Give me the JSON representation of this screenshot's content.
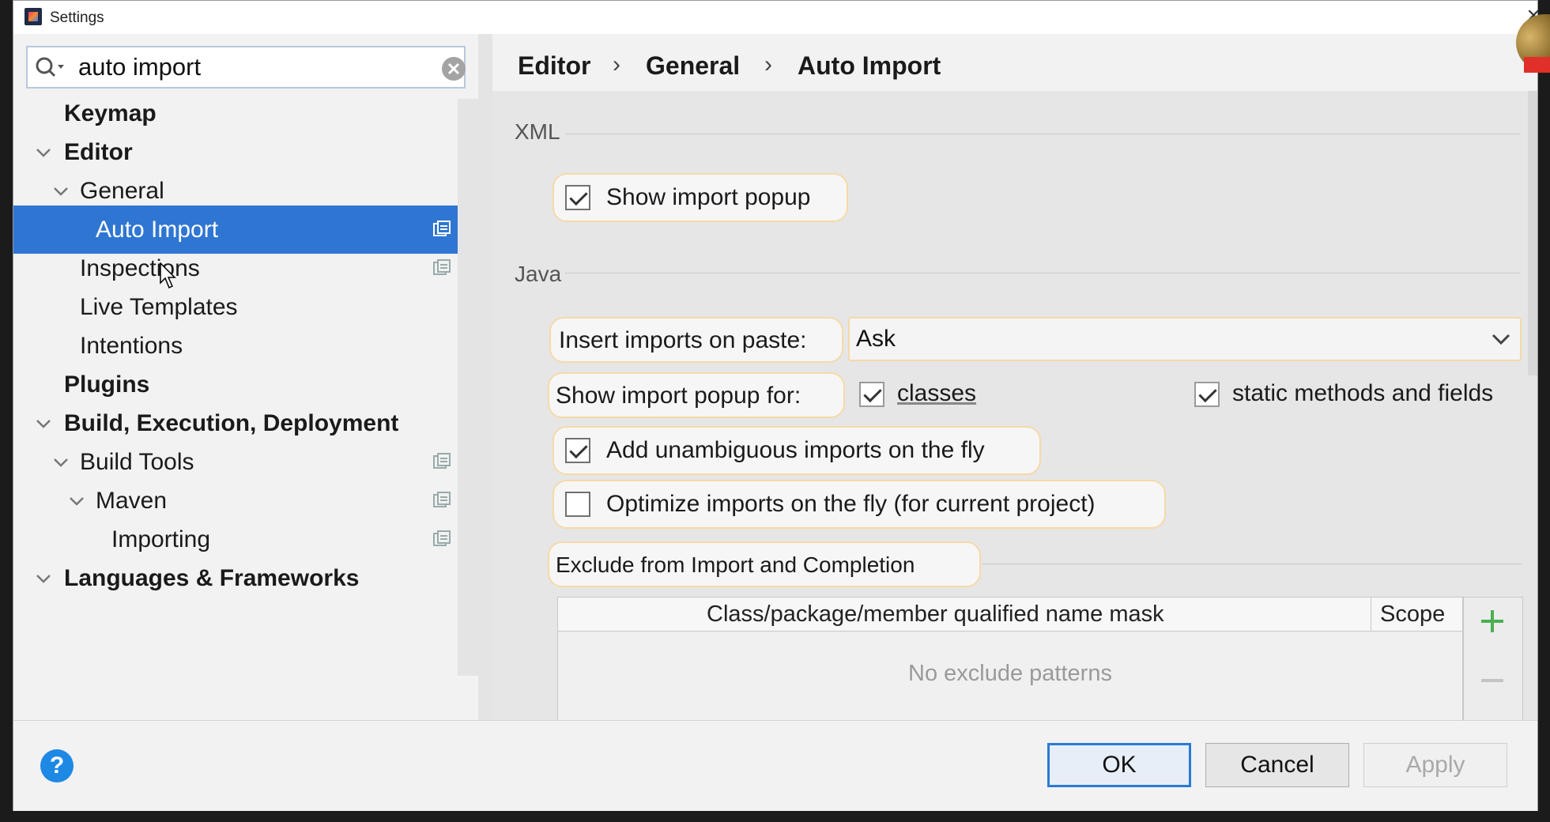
{
  "window": {
    "title": "Settings"
  },
  "search": {
    "value": "auto import"
  },
  "tree": [
    {
      "label": "Keymap",
      "bold": true,
      "expand": "none"
    },
    {
      "label": "Editor",
      "bold": true,
      "expand": "down"
    },
    {
      "label": "General",
      "bold": false,
      "expand": "down"
    },
    {
      "label": "Auto Import",
      "bold": false,
      "expand": "none",
      "selected": true
    },
    {
      "label": "Inspections",
      "bold": false,
      "expand": "none"
    },
    {
      "label": "Live Templates",
      "bold": false,
      "expand": "none"
    },
    {
      "label": "Intentions",
      "bold": false,
      "expand": "none"
    },
    {
      "label": "Plugins",
      "bold": true,
      "expand": "none"
    },
    {
      "label": "Build, Execution, Deployment",
      "bold": true,
      "expand": "down"
    },
    {
      "label": "Build Tools",
      "bold": false,
      "expand": "down"
    },
    {
      "label": "Maven",
      "bold": false,
      "expand": "down"
    },
    {
      "label": "Importing",
      "bold": false,
      "expand": "none"
    },
    {
      "label": "Languages & Frameworks",
      "bold": true,
      "expand": "down"
    }
  ],
  "breadcrumb": [
    "Editor",
    "General",
    "Auto Import"
  ],
  "xml": {
    "section": "XML",
    "show_import_popup": {
      "label": "Show import popup",
      "checked": true
    }
  },
  "java": {
    "section": "Java",
    "insert_on_paste_label": "Insert imports on paste:",
    "insert_on_paste_value": "Ask",
    "show_popup_for_label": "Show import popup for:",
    "classes": {
      "label": "classes",
      "checked": true
    },
    "static_methods": {
      "label": "static methods and fields",
      "checked": true
    },
    "add_unambiguous": {
      "label": "Add unambiguous imports on the fly",
      "checked": true
    },
    "optimize_imports": {
      "label": "Optimize imports on the fly (for current project)",
      "checked": false
    },
    "exclude_label": "Exclude from Import and Completion",
    "table": {
      "columns": [
        "Class/package/member qualified name mask",
        "Scope"
      ],
      "empty_text": "No exclude patterns"
    }
  },
  "footer": {
    "help": "?",
    "ok": "OK",
    "cancel": "Cancel",
    "apply": "Apply"
  },
  "colors": {
    "selection": "#2f76d2",
    "highlight_border": "#f6d9a8",
    "help": "#1e88e5"
  }
}
